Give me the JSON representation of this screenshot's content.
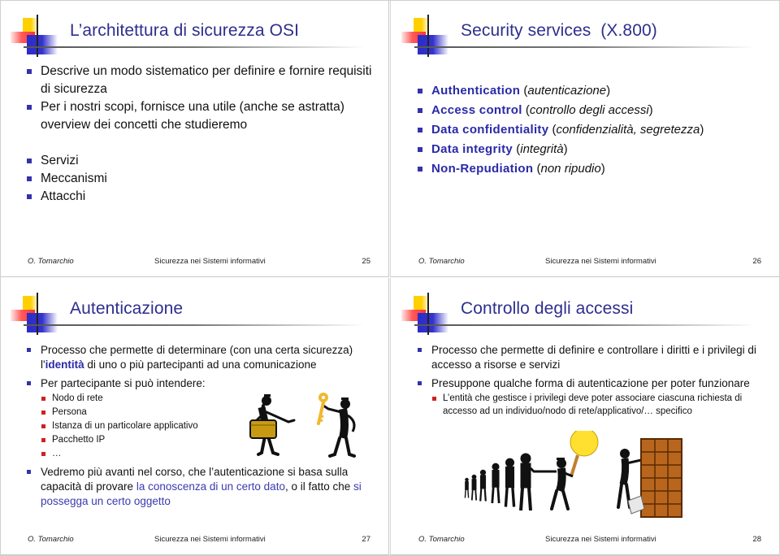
{
  "slides": [
    {
      "title": "L’architettura di sicurezza OSI",
      "bullets": [
        "Descrive un modo sistematico per definire e fornire requisiti di sicurezza",
        "Per i nostri scopi, fornisce una utile (anche se astratta) overview dei concetti che studieremo",
        "Servizi",
        "Meccanismi",
        "Attacchi"
      ],
      "footer": {
        "author": "O. Tomarchio",
        "course": "Sicurezza nei Sistemi informativi",
        "page": "25"
      }
    },
    {
      "title": "Security services  (X.800)",
      "services": [
        {
          "term": "Authentication",
          "translation": "autenticazione"
        },
        {
          "term": "Access control",
          "translation": "controllo degli accessi"
        },
        {
          "term": "Data confidentiality",
          "translation": "confidenzialità, segretezza"
        },
        {
          "term": "Data integrity",
          "translation": "integrità"
        },
        {
          "term": "Non-Repudiation",
          "translation": "non ripudio"
        }
      ],
      "footer": {
        "author": "O. Tomarchio",
        "course": "Sicurezza nei Sistemi informativi",
        "page": "26"
      }
    },
    {
      "title": "Autenticazione",
      "bullet1": {
        "before": "Processo che permette di determinare (con una certa sicurezza) l'",
        "highlight": "identità",
        "after": " di uno o più partecipanti ad una comunicazione"
      },
      "bullet2": "Per partecipante si può intendere:",
      "sub_items": [
        "Nodo di rete",
        "Persona",
        "Istanza di un particolare applicativo",
        "Pacchetto IP",
        "…"
      ],
      "bullet3": {
        "part1": "Vedremo più avanti nel corso, che l’autenticazione si basa sulla capacità di provare ",
        "highlight1": "la conoscenza di un certo dato",
        "part2": ", o il fatto che ",
        "highlight2": "si possegga un certo oggetto"
      },
      "clipart": "person-with-suitcase-and-person-with-key",
      "footer": {
        "author": "O. Tomarchio",
        "course": "Sicurezza nei Sistemi informativi",
        "page": "27"
      }
    },
    {
      "title": "Controllo degli accessi",
      "bullets": [
        "Processo che permette di definire e controllare i diritti e i privilegi di accesso a risorse e servizi",
        "Presuppone qualche forma di autenticazione per poter funzionare"
      ],
      "sub_items": [
        "L’entità che gestisce i privilegi deve poter associare ciascuna richiesta di accesso ad un individuo/nodo di rete/applicativo/… specifico"
      ],
      "clipart": "queue-of-people-stop-sign-and-mailbox-shelf",
      "footer": {
        "author": "O. Tomarchio",
        "course": "Sicurezza nei Sistemi informativi",
        "page": "28"
      }
    }
  ],
  "colors": {
    "title": "#2e2e8e",
    "term": "#2a2aa8",
    "bullet_level1": "#3333aa",
    "bullet_level2": "#cc2222",
    "logo_yellow": "#ffd000",
    "logo_red": "#ff4444",
    "logo_blue": "#3333cc"
  }
}
